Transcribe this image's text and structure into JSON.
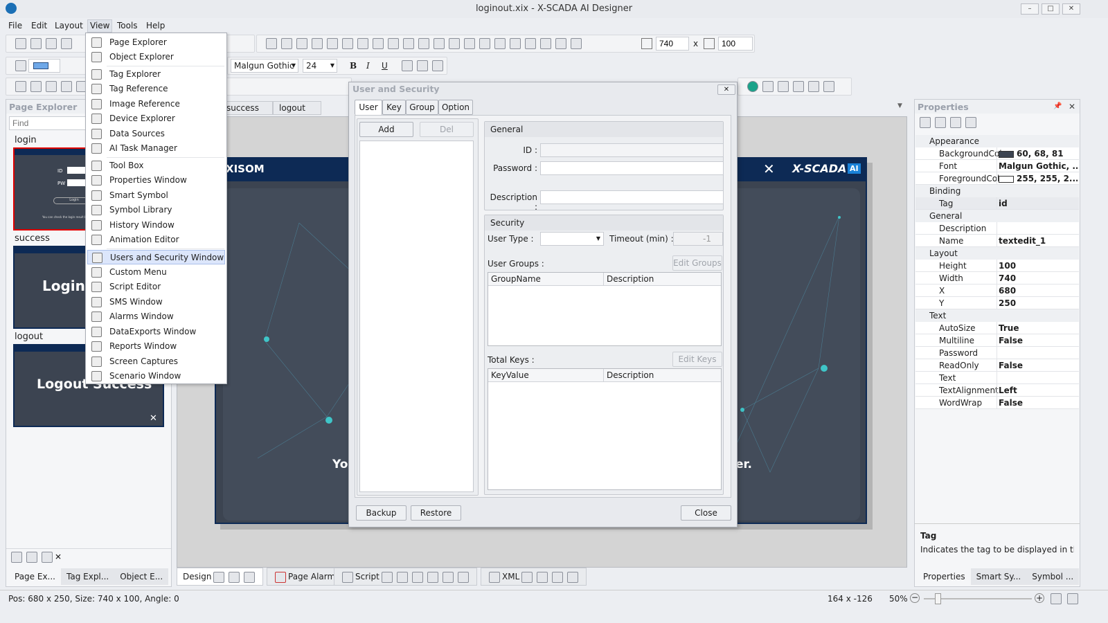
{
  "window": {
    "title": "loginout.xix - X-SCADA AI Designer",
    "controls": [
      "–",
      "□",
      "✕"
    ]
  },
  "menu": [
    "File",
    "Edit",
    "Layout",
    "View",
    "Tools",
    "Help"
  ],
  "toolbar": {
    "width_value": "740",
    "height_value": "100",
    "size_sep": "x",
    "font_name": "Malgun Gothic",
    "font_size": "24",
    "bold": "B",
    "italic": "I",
    "underline": "U",
    "fill_color": "#6fa8e8"
  },
  "view_menu": [
    {
      "label": "Page Explorer",
      "icon": "page-explorer-icon"
    },
    {
      "label": "Object Explorer",
      "icon": "object-explorer-icon"
    },
    {
      "label": "Tag Explorer",
      "icon": "tag-explorer-icon"
    },
    {
      "label": "Tag Reference",
      "icon": "tag-icon"
    },
    {
      "label": "Image Reference",
      "icon": "image-icon"
    },
    {
      "label": "Device Explorer",
      "icon": "chip-icon"
    },
    {
      "label": "Data Sources",
      "icon": "database-icon"
    },
    {
      "label": "AI Task Manager",
      "icon": "ai-icon"
    },
    {
      "label": "Tool Box",
      "icon": "toolbox-icon"
    },
    {
      "label": "Properties Window",
      "icon": "properties-icon"
    },
    {
      "label": "Smart Symbol",
      "icon": "smart-symbol-icon"
    },
    {
      "label": "Symbol Library",
      "icon": "book-icon"
    },
    {
      "label": "History Window",
      "icon": "history-icon"
    },
    {
      "label": "Animation Editor",
      "icon": "wand-icon"
    },
    {
      "label": "Users and Security Window",
      "icon": "user-icon"
    },
    {
      "label": "Custom Menu",
      "icon": "menu-icon"
    },
    {
      "label": "Script Editor",
      "icon": "script-icon"
    },
    {
      "label": "SMS Window",
      "icon": "sms-icon"
    },
    {
      "label": "Alarms Window",
      "icon": "alarm-clock-icon"
    },
    {
      "label": "DataExports Window",
      "icon": "export-icon"
    },
    {
      "label": "Reports Window",
      "icon": "report-icon"
    },
    {
      "label": "Screen Captures",
      "icon": "camera-icon"
    },
    {
      "label": "Scenario Window",
      "icon": "scenario-icon"
    }
  ],
  "page_explorer": {
    "title": "Page Explorer",
    "find_placeholder": "Find",
    "pages": [
      {
        "name": "login",
        "thumb_texts": [
          "ID",
          "PW",
          "Login",
          "You can check the login result by"
        ]
      },
      {
        "name": "success",
        "thumb_texts": [
          "Login"
        ]
      },
      {
        "name": "logout",
        "thumb_texts": [
          "Logout Success",
          "✕"
        ]
      }
    ],
    "tabs": [
      "Page Ex...",
      "Tag Expl...",
      "Object E..."
    ]
  },
  "doc_tabs": [
    "success",
    "logout"
  ],
  "design": {
    "brand_left": "XISOM",
    "brand_right": "X-SCADA",
    "brand_badge": "AI",
    "close": "✕",
    "text_left": "Yo",
    "text_right": "er.",
    "header_color": "#0d2a55",
    "body_color": "#3c4451"
  },
  "bottom_tabs": {
    "design": "Design",
    "page_alarm": "Page Alarm",
    "script": "Script",
    "xml": "XML"
  },
  "dialog": {
    "title": "User and Security",
    "close": "✕",
    "tabs": [
      "User",
      "Key",
      "Group",
      "Option"
    ],
    "add": "Add",
    "del": "Del",
    "general": {
      "title": "General",
      "id_label": "ID :",
      "password_label": "Password :",
      "description_label": "Description :"
    },
    "security": {
      "title": "Security",
      "user_type_label": "User Type :",
      "timeout_label": "Timeout (min) :",
      "timeout_value": "-1",
      "user_groups_label": "User Groups :",
      "edit_groups": "Edit Groups",
      "group_columns": [
        "GroupName",
        "Description"
      ],
      "total_keys_label": "Total Keys :",
      "edit_keys": "Edit Keys",
      "key_columns": [
        "KeyValue",
        "Description"
      ]
    },
    "backup": "Backup",
    "restore": "Restore",
    "close_button": "Close"
  },
  "properties": {
    "title": "Properties",
    "groups": [
      {
        "name": "Appearance",
        "rows": [
          {
            "k": "BackgroundColc",
            "v": "60, 68, 81",
            "swatch": "#3c4451"
          },
          {
            "k": "Font",
            "v": "Malgun Gothic, ..."
          },
          {
            "k": "ForegroundColc",
            "v": "255, 255, 2...",
            "swatch": "#ffffff"
          }
        ]
      },
      {
        "name": "Binding",
        "rows": [
          {
            "k": "Tag",
            "v": "id"
          }
        ]
      },
      {
        "name": "General",
        "rows": [
          {
            "k": "Description",
            "v": ""
          },
          {
            "k": "Name",
            "v": "textedit_1"
          }
        ]
      },
      {
        "name": "Layout",
        "rows": [
          {
            "k": "Height",
            "v": "100"
          },
          {
            "k": "Width",
            "v": "740"
          },
          {
            "k": "X",
            "v": "680"
          },
          {
            "k": "Y",
            "v": "250"
          }
        ]
      },
      {
        "name": "Text",
        "rows": [
          {
            "k": "AutoSize",
            "v": "True"
          },
          {
            "k": "Multiline",
            "v": "False"
          },
          {
            "k": "Password",
            "v": ""
          },
          {
            "k": "ReadOnly",
            "v": "False"
          },
          {
            "k": "Text",
            "v": ""
          },
          {
            "k": "TextAlignment",
            "v": "Left"
          },
          {
            "k": "WordWrap",
            "v": "False"
          }
        ]
      }
    ],
    "help_title": "Tag",
    "help_text": "Indicates the tag to be displayed in th...",
    "tabs": [
      "Properties",
      "Smart Sy...",
      "Symbol ..."
    ]
  },
  "status": {
    "left": "Pos: 680 x 250, Size: 740 x 100, Angle: 0",
    "coords": "164 x -126",
    "zoom": "50%",
    "zoom_level": 50
  }
}
